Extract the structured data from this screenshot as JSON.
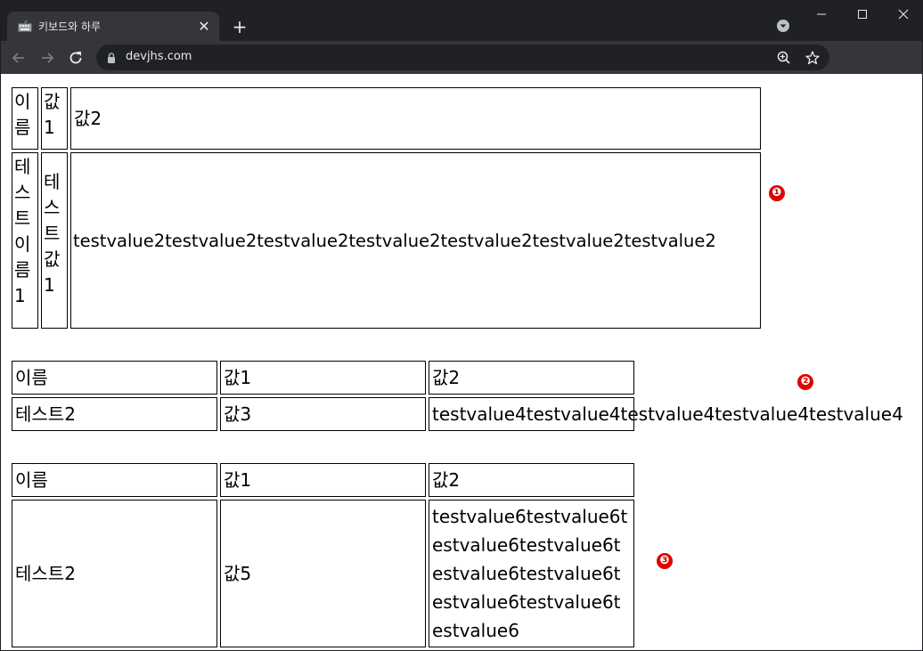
{
  "browser": {
    "tab_title": "키보드와 하루",
    "url": "devjhs.com",
    "icons": [
      "keyboard-favicon-icon",
      "close-icon",
      "plus-icon",
      "tab-search-icon",
      "minimize-icon",
      "maximize-icon",
      "close-window-icon",
      "back-arrow-icon",
      "forward-arrow-icon",
      "reload-icon",
      "lock-icon",
      "zoom-icon",
      "star-icon"
    ]
  },
  "tables": [
    {
      "header": [
        "이름",
        "값1",
        "값2"
      ],
      "row": [
        "테스트이름1",
        "테스트값1",
        "testvalue2testvalue2testvalue2testvalue2testvalue2testvalue2testvalue2"
      ]
    },
    {
      "header": [
        "이름",
        "값1",
        "값2"
      ],
      "row": [
        "테스트2",
        "값3",
        "testvalue4testvalue4testvalue4testvalue4testvalue4"
      ]
    },
    {
      "header": [
        "이름",
        "값1",
        "값2"
      ],
      "row": [
        "테스트2",
        "값5",
        "testvalue6testvalue6testvalue6testvalue6testvalue6testvalue6testvalue6testvalue6testvalue6"
      ]
    }
  ],
  "markers": [
    "❶",
    "❷",
    "❸"
  ],
  "colors": {
    "marker": "#e00000",
    "tabstrip": "#202124",
    "toolbar": "#35363a"
  }
}
